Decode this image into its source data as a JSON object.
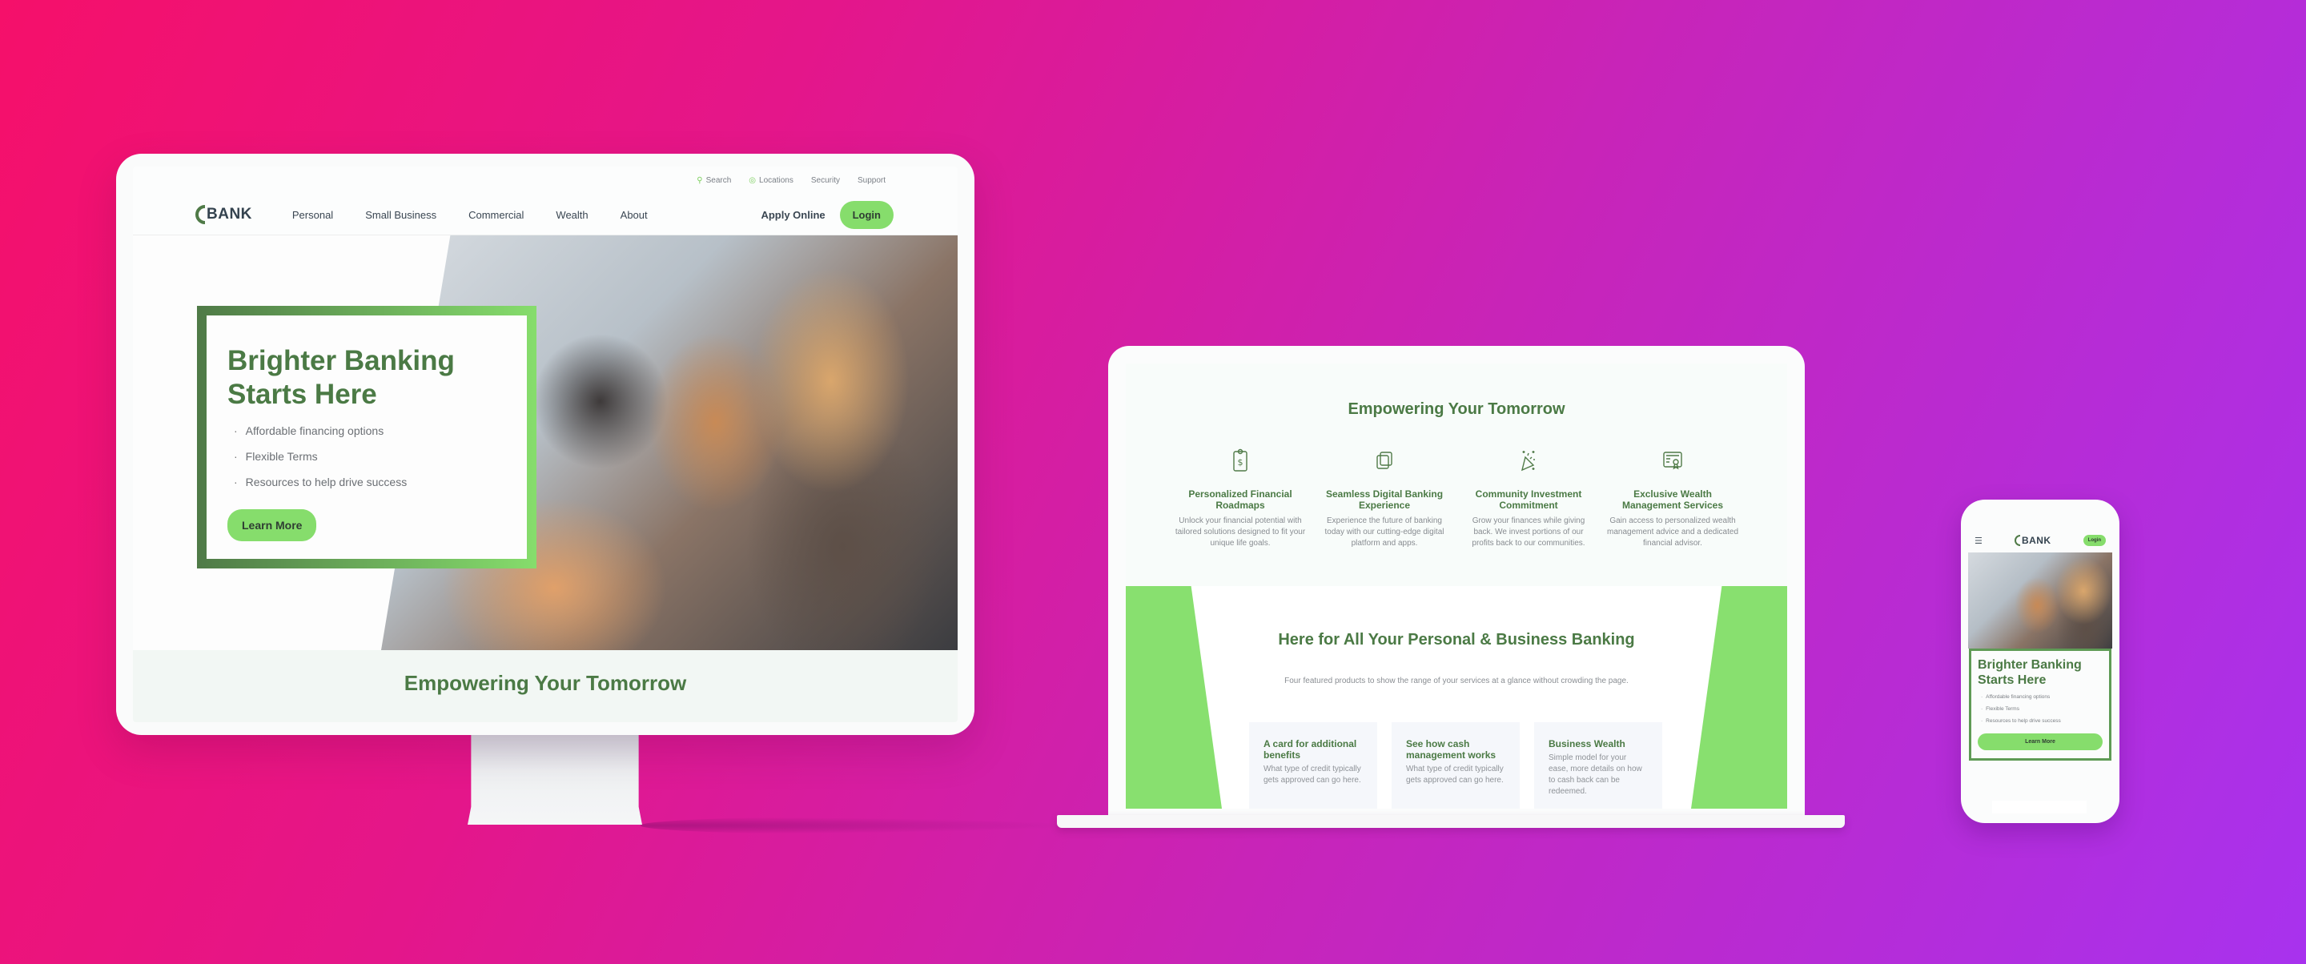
{
  "brand": {
    "logo_text": "BANK",
    "colors": {
      "primary_green": "#4b7a45",
      "accent_green": "#86dd6c",
      "background_start": "#f5106a",
      "background_end": "#a832ee"
    }
  },
  "desktop": {
    "utility_nav": [
      {
        "label": "Search",
        "icon": "search-icon"
      },
      {
        "label": "Locations",
        "icon": "location-pin-icon"
      },
      {
        "label": "Security"
      },
      {
        "label": "Support"
      }
    ],
    "main_nav": [
      "Personal",
      "Small Business",
      "Commercial",
      "Wealth",
      "About"
    ],
    "apply_label": "Apply Online",
    "login_label": "Login",
    "hero": {
      "title": "Brighter Banking Starts Here",
      "bullets": [
        "Affordable financing options",
        "Flexible Terms",
        "Resources to help drive success"
      ],
      "cta_label": "Learn More"
    },
    "section_title": "Empowering Your Tomorrow"
  },
  "laptop": {
    "section_title": "Empowering Your Tomorrow",
    "features": [
      {
        "icon": "clipboard-dollar-icon",
        "title": "Personalized Financial Roadmaps",
        "text": "Unlock your financial potential with tailored solutions designed to fit your unique life goals."
      },
      {
        "icon": "overlapping-squares-icon",
        "title": "Seamless Digital Banking Experience",
        "text": "Experience the future of banking today with our cutting-edge digital platform and apps."
      },
      {
        "icon": "party-popper-icon",
        "title": "Community Investment Commitment",
        "text": "Grow your finances while giving back. We invest portions of our profits back to our communities."
      },
      {
        "icon": "certificate-icon",
        "title": "Exclusive Wealth Management Services",
        "text": "Gain access to personalized wealth management advice and a dedicated financial advisor."
      }
    ],
    "products_section": {
      "title": "Here for All Your Personal & Business Banking",
      "subtitle": "Four featured products to show the range of your services at a glance without crowding the page.",
      "products": [
        {
          "title": "A card for additional benefits",
          "text": "What type of credit typically gets approved can go here."
        },
        {
          "title": "See how cash management works",
          "text": "What type of credit typically gets approved can go here."
        },
        {
          "title": "Business Wealth",
          "text": "Simple model for your ease, more details on how to cash back can be redeemed."
        }
      ]
    }
  },
  "mobile": {
    "menu_icon": "hamburger-icon",
    "login_label": "Login",
    "hero": {
      "title": "Brighter Banking Starts Here",
      "bullets": [
        "Affordable financing options",
        "Flexible Terms",
        "Resources to help drive success"
      ],
      "cta_label": "Learn More"
    }
  }
}
